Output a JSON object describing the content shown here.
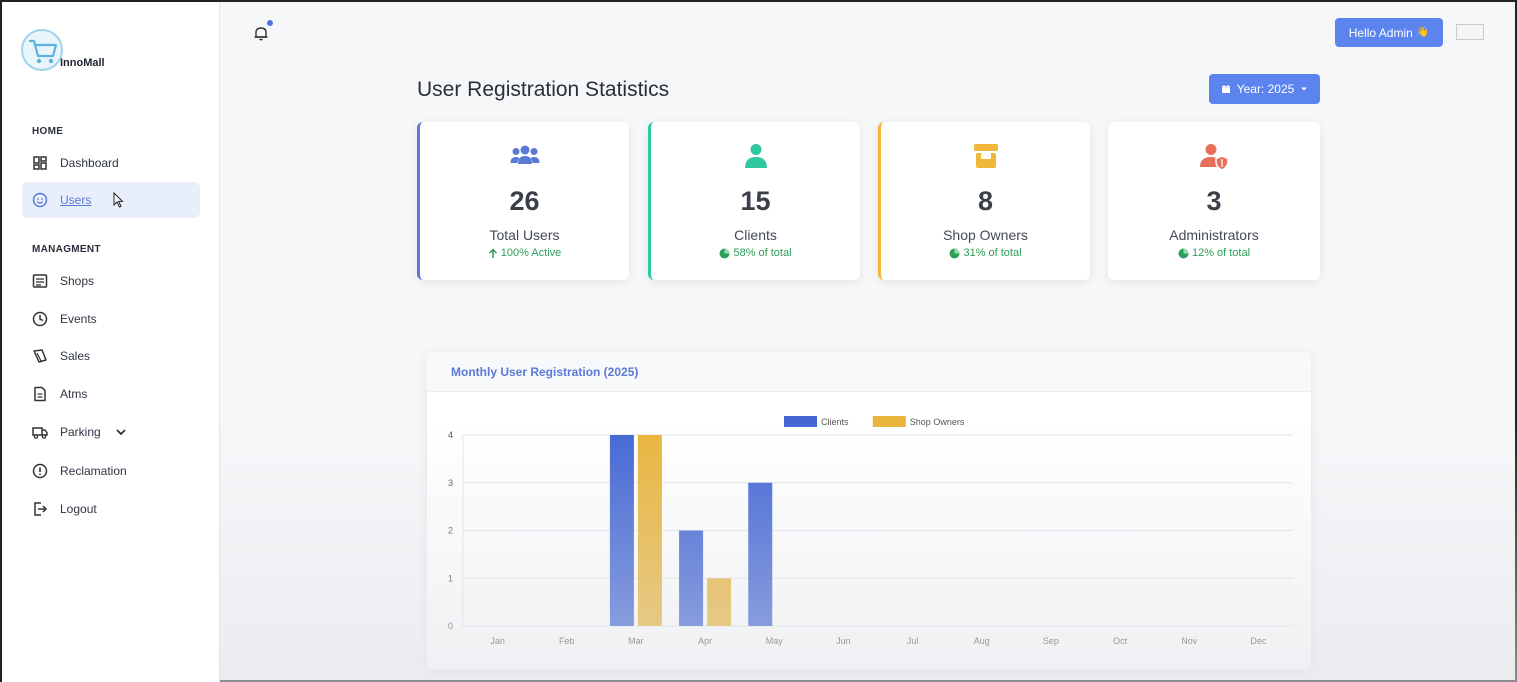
{
  "brand": {
    "name": "InnoMall"
  },
  "sidebar": {
    "sections": [
      {
        "label": "HOME"
      },
      {
        "label": "MANAGMENT"
      }
    ],
    "items": [
      {
        "label": "Dashboard",
        "icon": "dashboard-icon"
      },
      {
        "label": "Users",
        "icon": "users-icon",
        "active": true
      },
      {
        "label": "Shops",
        "icon": "list-icon"
      },
      {
        "label": "Events",
        "icon": "clock-icon"
      },
      {
        "label": "Sales",
        "icon": "tag-icon"
      },
      {
        "label": "Atms",
        "icon": "document-icon"
      },
      {
        "label": "Parking",
        "icon": "truck-icon"
      },
      {
        "label": "Reclamation",
        "icon": "alert-icon"
      },
      {
        "label": "Logout",
        "icon": "logout-icon"
      }
    ]
  },
  "header": {
    "hello_label": "Hello Admin",
    "hello_emoji": "👋"
  },
  "main": {
    "title": "User Registration Statistics",
    "year_label": "Year: 2025",
    "cards": [
      {
        "value": "26",
        "label": "Total Users",
        "sub": "100% Active",
        "color": "#5a7ad6"
      },
      {
        "value": "15",
        "label": "Clients",
        "sub": "58% of total",
        "color": "#2fc9a0"
      },
      {
        "value": "8",
        "label": "Shop Owners",
        "sub": "31% of total",
        "color": "#f0b73a"
      },
      {
        "value": "3",
        "label": "Administrators",
        "sub": "12% of total",
        "color": "#e8705a"
      }
    ],
    "chart_title": "Monthly User Registration (2025)"
  },
  "colors": {
    "accent": "#5b84ee",
    "clients": "#4467d4",
    "shop_owners": "#e9b53c",
    "positive": "#2e9e5a"
  },
  "chart_data": {
    "type": "bar",
    "categories": [
      "Jan",
      "Feb",
      "Mar",
      "Apr",
      "May",
      "Jun",
      "Jul",
      "Aug",
      "Sep",
      "Oct",
      "Nov",
      "Dec"
    ],
    "series": [
      {
        "name": "Clients",
        "values": [
          0,
          0,
          4,
          2,
          3,
          0,
          0,
          0,
          0,
          0,
          0,
          0
        ]
      },
      {
        "name": "Shop Owners",
        "values": [
          0,
          0,
          4,
          1,
          0,
          0,
          0,
          0,
          0,
          0,
          0,
          0
        ]
      }
    ],
    "yticks": [
      "0",
      "1",
      "2",
      "3",
      "4"
    ],
    "ylim": [
      0,
      4
    ],
    "legend": "top-center",
    "grid": true
  }
}
